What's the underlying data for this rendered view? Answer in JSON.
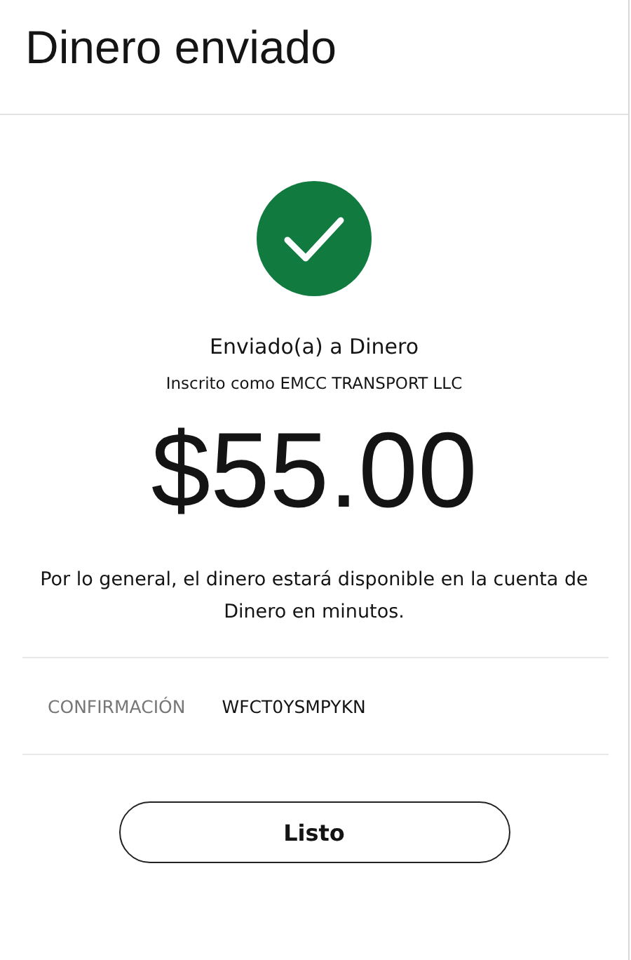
{
  "header": {
    "title": "Dinero enviado"
  },
  "result": {
    "succeeded": true,
    "heading": "Enviado(a) a Dinero",
    "enrolled_as": "Inscrito como EMCC TRANSPORT LLC",
    "amount": "$55.00",
    "note": "Por lo general, el dinero estará disponible en la cuenta de Dinero en minutos."
  },
  "confirmation": {
    "label": "CONFIRMACIÓN",
    "value": "WFCT0YSMPYKN"
  },
  "buttons": [
    "Listo"
  ]
}
